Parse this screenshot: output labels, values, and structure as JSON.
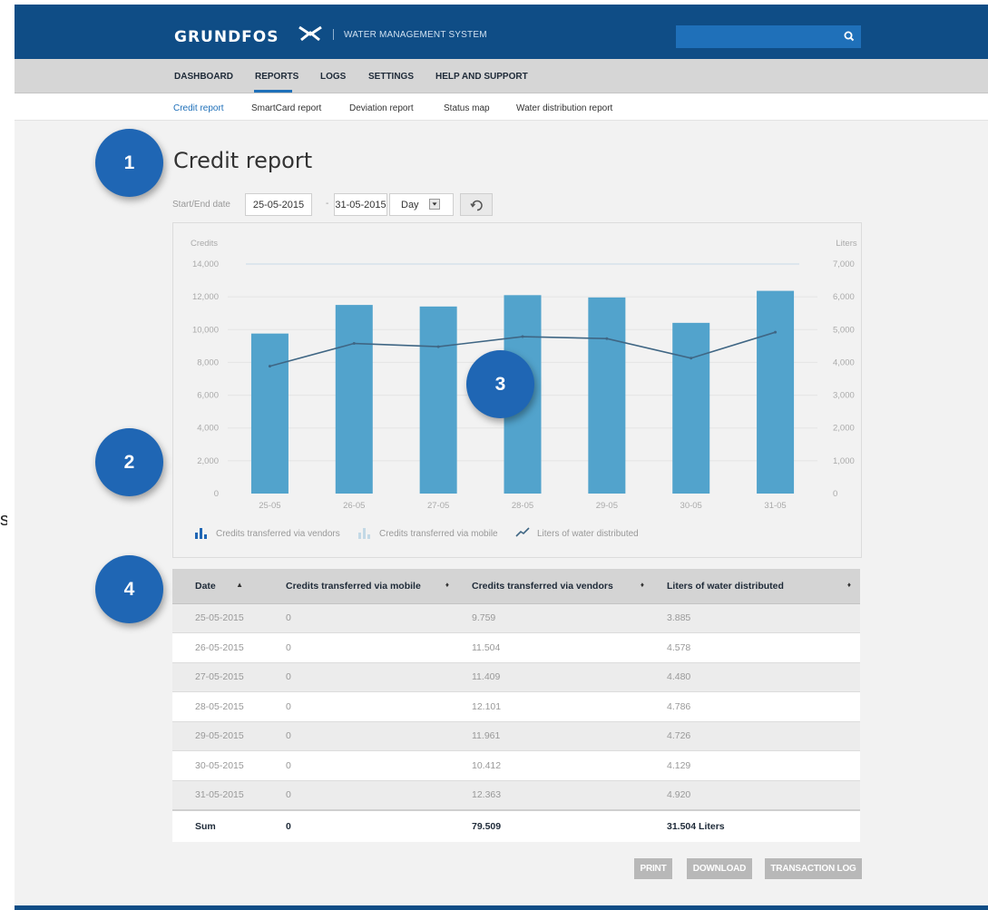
{
  "brand": {
    "name": "GRUNDFOS",
    "subtitle": "WATER MANAGEMENT SYSTEM"
  },
  "search": {
    "placeholder": "",
    "icon": "search-icon"
  },
  "main_nav": [
    {
      "label": "DASHBOARD",
      "active": false
    },
    {
      "label": "REPORTS",
      "active": true
    },
    {
      "label": "LOGS",
      "active": false
    },
    {
      "label": "SETTINGS",
      "active": false
    },
    {
      "label": "HELP AND SUPPORT",
      "active": false
    }
  ],
  "sub_nav": [
    {
      "label": "Credit report",
      "active": true
    },
    {
      "label": "SmartCard report",
      "active": false
    },
    {
      "label": "Deviation report",
      "active": false
    },
    {
      "label": "Status map",
      "active": false
    },
    {
      "label": "Water distribution report",
      "active": false
    }
  ],
  "page_title": "Credit report",
  "filters": {
    "date_label": "Start/End date",
    "start_date": "25-05-2015",
    "end_date": "31-05-2015",
    "separator": "-",
    "period": "Day",
    "refresh_icon": "refresh-icon"
  },
  "chart_data": {
    "type": "bar",
    "ylabel": "Credits",
    "y2label": "Liters",
    "ylim": [
      0,
      14000
    ],
    "y2lim": [
      0,
      7000
    ],
    "yticks": [
      "14,000",
      "12,000",
      "10,000",
      "8,000",
      "6,000",
      "4,000",
      "2,000",
      "0"
    ],
    "y2ticks": [
      "7,000",
      "6,000",
      "5,000",
      "4,000",
      "3,000",
      "2,000",
      "1,000",
      "0"
    ],
    "categories": [
      "25-05",
      "26-05",
      "27-05",
      "28-05",
      "29-05",
      "30-05",
      "31-05"
    ],
    "series": [
      {
        "name": "Credits transferred via vendors",
        "kind": "bar",
        "axis": "left",
        "color": "#52a3cc",
        "values": [
          9759,
          11504,
          11409,
          12101,
          11961,
          10412,
          12363
        ]
      },
      {
        "name": "Credits transferred via mobile",
        "kind": "bar",
        "axis": "left",
        "color": "#c3d9e6",
        "values": [
          0,
          0,
          0,
          0,
          0,
          0,
          0
        ]
      },
      {
        "name": "Liters of water distributed",
        "kind": "line",
        "axis": "right",
        "color": "#3f6684",
        "values": [
          3885,
          4578,
          4480,
          4786,
          4726,
          4129,
          4920
        ]
      }
    ],
    "grid": true,
    "legend_position": "bottom-left"
  },
  "table": {
    "columns": [
      {
        "label": "Date",
        "sort_icon": "sort-ascending-icon",
        "glyph": "▲"
      },
      {
        "label": "Credits transferred via mobile",
        "sort_icon": "sort-icon",
        "glyph": "♦"
      },
      {
        "label": "Credits transferred via vendors",
        "sort_icon": "sort-icon",
        "glyph": "♦"
      },
      {
        "label": "Liters of water distributed",
        "sort_icon": "sort-icon",
        "glyph": "♦"
      }
    ],
    "rows": [
      [
        "25-05-2015",
        "0",
        "9.759",
        "3.885"
      ],
      [
        "26-05-2015",
        "0",
        "11.504",
        "4.578"
      ],
      [
        "27-05-2015",
        "0",
        "11.409",
        "4.480"
      ],
      [
        "28-05-2015",
        "0",
        "12.101",
        "4.786"
      ],
      [
        "29-05-2015",
        "0",
        "11.961",
        "4.726"
      ],
      [
        "30-05-2015",
        "0",
        "10.412",
        "4.129"
      ],
      [
        "31-05-2015",
        "0",
        "12.363",
        "4.920"
      ]
    ],
    "sum": [
      "Sum",
      "0",
      "79.509",
      "31.504 Liters"
    ]
  },
  "actions": {
    "print": "PRINT",
    "download": "DOWNLOAD",
    "transaction_log": "TRANSACTION LOG"
  },
  "callouts": [
    "1",
    "2",
    "3",
    "4"
  ],
  "edge_fragment": "s",
  "colors": {
    "brand_blue": "#0f4d86",
    "accent": "#1f70b9",
    "bar": "#52a3cc",
    "line": "#3f6684",
    "callout": "#1f66b4"
  }
}
